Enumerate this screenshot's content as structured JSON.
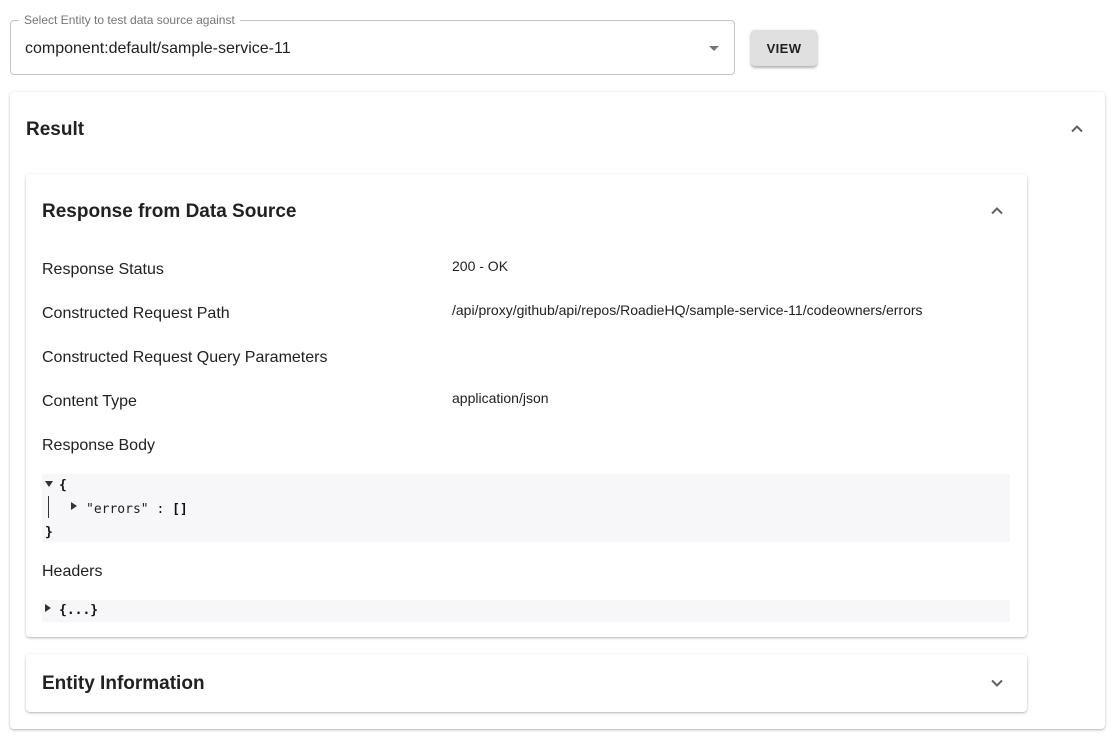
{
  "entity_select": {
    "label": "Select Entity to test data source against",
    "value": "component:default/sample-service-11"
  },
  "view_button": {
    "label": "VIEW"
  },
  "result": {
    "title": "Result",
    "response": {
      "title": "Response from Data Source",
      "rows": [
        {
          "label": "Response Status",
          "value": "200 - OK"
        },
        {
          "label": "Constructed Request Path",
          "value": "/api/proxy/github/api/repos/RoadieHQ/sample-service-11/codeowners/errors"
        },
        {
          "label": "Constructed Request Query Parameters",
          "value": ""
        },
        {
          "label": "Content Type",
          "value": "application/json"
        }
      ],
      "body_label": "Response Body",
      "body": {
        "open_brace": "{",
        "key": "\"errors\"",
        "colon": " : ",
        "value": "[]",
        "close_brace": "}"
      },
      "headers_label": "Headers",
      "headers_collapsed": "{...}"
    },
    "entity_information": {
      "title": "Entity Information"
    }
  },
  "icons": {
    "select_arrow": "arrow-drop-down-icon",
    "collapse": "chevron-up-icon",
    "expand": "chevron-down-icon"
  },
  "colors": {
    "json_background": "#f7f7f9",
    "button_background": "#e0e0e0",
    "border": "#c4c4c4"
  }
}
